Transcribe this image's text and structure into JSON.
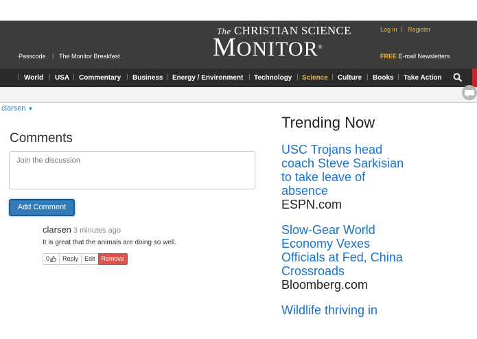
{
  "header": {
    "left_links": [
      "Passcode",
      "The Monitor Breakfast"
    ],
    "logo_top_prefix": "The",
    "logo_top": "CHRISTIAN SCIENCE",
    "logo_main_first": "M",
    "logo_main_rest": "ONITOR",
    "logo_mark": "®",
    "login": "Log in",
    "register": "Register",
    "newsletter_prefix": "FREE",
    "newsletter": "E-mail Newsletters",
    "accent_color": "#f2b431"
  },
  "nav": {
    "items": [
      "World",
      "USA",
      "Commentary",
      "Business",
      "Energy / Environment",
      "Technology",
      "Science",
      "Culture",
      "Books",
      "Take Action"
    ],
    "active": "Science",
    "search_icon": "search-icon"
  },
  "user_menu": {
    "label": "clarsen"
  },
  "comments": {
    "heading": "Comments",
    "placeholder": "Join the discussion",
    "add_button": "Add Comment",
    "items": [
      {
        "author": "clarsen",
        "time": "3 minutes ago",
        "text": "It is great that the animals are doing so well.",
        "likes": "0",
        "reply": "Reply",
        "edit": "Edit",
        "remove": "Remove"
      }
    ]
  },
  "trending": {
    "heading": "Trending Now",
    "items": [
      {
        "title": "USC Trojans head coach Steve Sarkisian to take leave of absence",
        "source": "ESPN.com"
      },
      {
        "title": "Slow-Gear World Economy Vexes Officials at Fed, China Crossroads",
        "source": "Bloomberg.com"
      },
      {
        "title": "Wildlife thriving in",
        "source": ""
      }
    ],
    "link_color": "#1a73c9"
  }
}
